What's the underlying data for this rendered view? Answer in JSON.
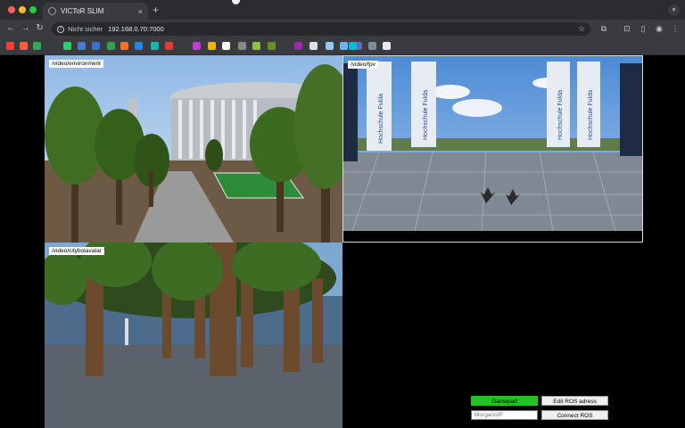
{
  "browser": {
    "tab_title": "VICToR SLIM",
    "tab_close": "×",
    "new_tab": "+",
    "security_label": "Nicht sicher",
    "url": "192.168.0.70:7000"
  },
  "colors": {
    "chrome_bg": "#2b2c30",
    "toolbar_bg": "#3a3b3f",
    "page_bg": "#000000",
    "gamepad_active": "#22c322"
  },
  "bookmarks": [
    {
      "icon": "youtube-icon",
      "color": "#ff3b30"
    },
    {
      "icon": "gitlab-icon",
      "color": "#ff5a36"
    },
    {
      "icon": "sheets-icon",
      "color": "#34a853"
    },
    {
      "icon": "whatsapp-icon",
      "color": "#25d366"
    },
    {
      "icon": "mail-icon",
      "color": "#4a7bd1"
    },
    {
      "icon": "drive-icon",
      "color": "#3b6fd6"
    },
    {
      "icon": "bookmark-green-icon",
      "color": "#2ea44f"
    },
    {
      "icon": "gitlab-fox-icon",
      "color": "#fc6d26"
    },
    {
      "icon": "app-blue-icon",
      "color": "#1e88e5"
    },
    {
      "icon": "app-teal-icon",
      "color": "#14b8a6"
    },
    {
      "icon": "app-red-icon",
      "color": "#e53935"
    },
    {
      "icon": "gmail-icon",
      "color": "#c63bd1"
    },
    {
      "icon": "maps-icon",
      "color": "#f4b400"
    },
    {
      "icon": "docs-icon",
      "color": "#ffffff"
    },
    {
      "icon": "app-gray-icon",
      "color": "#888888"
    },
    {
      "icon": "app-lime-icon",
      "color": "#8bc34a"
    },
    {
      "icon": "app-olive-icon",
      "color": "#6b8e23"
    },
    {
      "icon": "app-purple-icon",
      "color": "#9c27b0"
    },
    {
      "icon": "app-white-icon",
      "color": "#e0e0e0"
    },
    {
      "icon": "app-lightblue-icon",
      "color": "#90caf9"
    },
    {
      "icon": "app-sky-icon",
      "color": "#64b5f6"
    },
    {
      "icon": "app-navy-icon",
      "color": "#5c6bc0"
    },
    {
      "icon": "app-slate-icon",
      "color": "#78909c"
    },
    {
      "icon": "github-icon",
      "color": "#e8eaed"
    },
    {
      "icon": "app-cyan-icon",
      "color": "#00bcd4"
    }
  ],
  "panels": {
    "environment_label": "/video/environment",
    "fpv_label": "/video/fpv",
    "avatar_label": "/video/citybotavatar"
  },
  "fpv_scene": {
    "banners_left": [
      "Hochschule Fulda",
      "Hochschule Fulda"
    ],
    "banners_right": [
      "Hochschule Fulda",
      "Hochschule Fulda"
    ]
  },
  "controls": {
    "gamepad_label": "Gamepad",
    "edit_ros_label": "Edit ROS adress",
    "connect_ros_label": "Connect ROS",
    "ip_placeholder": "MorganoIP"
  }
}
